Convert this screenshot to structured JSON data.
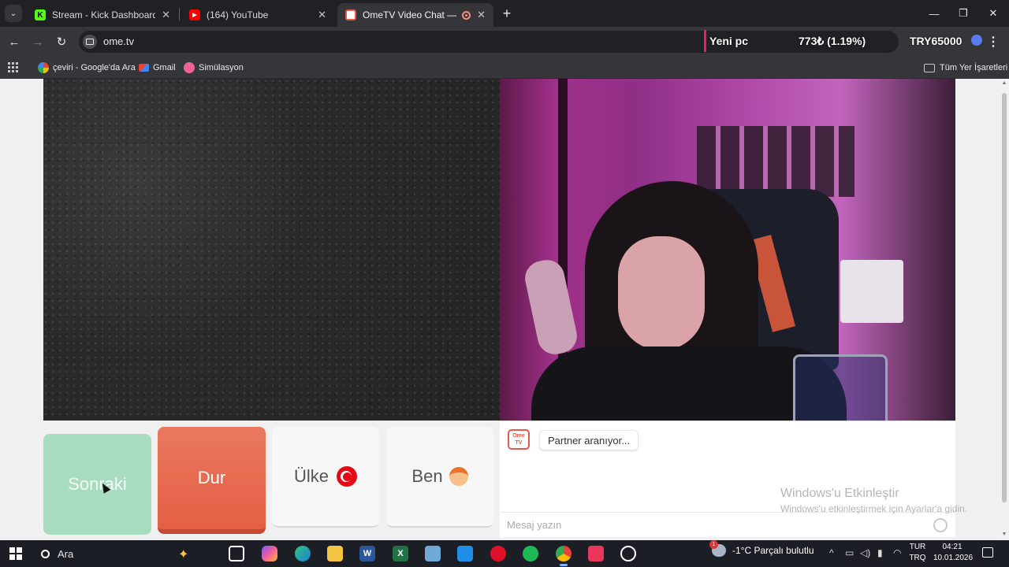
{
  "browser": {
    "tabs": [
      {
        "title": "Stream - Kick Dashboard",
        "favicon": "kick-icon",
        "color": "#53fc18"
      },
      {
        "title": "(164) YouTube",
        "favicon": "youtube-icon",
        "color": "#ff0000"
      },
      {
        "title": "OmeTV Video Chat — Omegle",
        "favicon": "ometv-icon",
        "color": "#e8574a"
      }
    ],
    "url": "ome.tv",
    "bookmarks": [
      {
        "label": "çeviri - Google'da Ara",
        "icon": "google-icon"
      },
      {
        "label": "Gmail",
        "icon": "gmail-icon"
      },
      {
        "label": "Simülasyon",
        "icon": "simulasyon-icon"
      }
    ],
    "all_bookmarks": "Tüm Yer İşaretleri"
  },
  "ticker": {
    "name": "Yeni pc",
    "change": "773₺ (1.19%)",
    "goal": "TRY65000"
  },
  "ometv": {
    "buttons": {
      "next": "Sonraki",
      "stop": "Dur",
      "country": "Ülke",
      "me": "Ben"
    },
    "logo_text": "Ome TV",
    "status_message": "Partner aranıyor...",
    "input_placeholder": "Mesaj yazın"
  },
  "windows_activation": {
    "title": "Windows'u Etkinleştir",
    "subtitle": "Windows'u etkinleştirmek için Ayarlar'a gidin."
  },
  "taskbar": {
    "search": "Ara",
    "weather": "-1°C  Parçalı bulutlu",
    "lang_top": "TUR",
    "lang_bottom": "TRQ",
    "time": "04:21",
    "date": "10.01.2026"
  },
  "colors": {
    "next_button": "#a8dcc1",
    "stop_button": "#e45f44",
    "accent_pink": "#e91e63"
  }
}
